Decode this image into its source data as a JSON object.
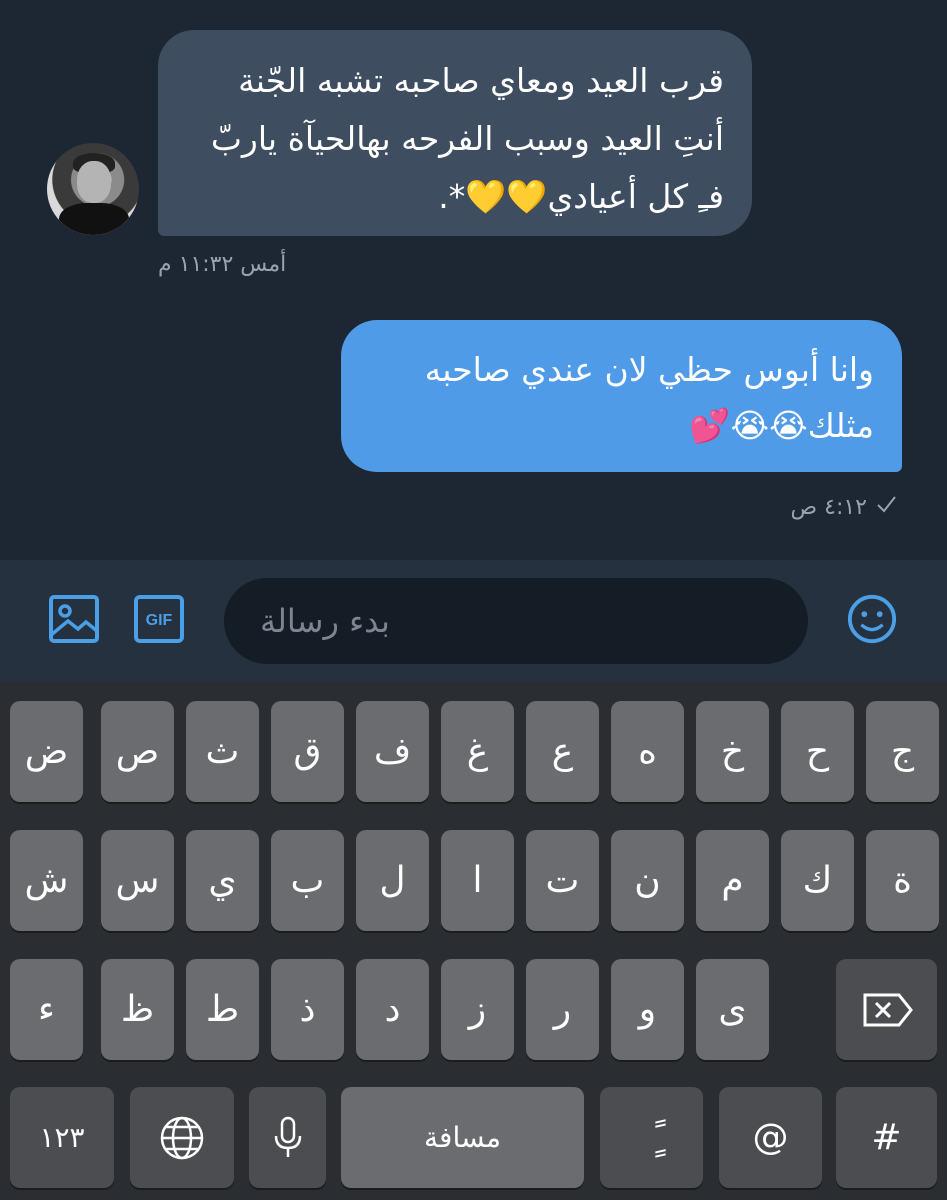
{
  "messages": {
    "incoming": {
      "lines": [
        "قرب العيد ومعاي صاحبه تشبه الجّنة",
        "أنتِ العيد وسبب الفرحه بهالحيآة ياربّ",
        "فـِ كل أعيادي💛💛*."
      ],
      "time": "أمس ١١:٣٢ م"
    },
    "outgoing": {
      "lines": [
        "وانا أبوس حظي لان عندي صاحبه",
        "مثلك😭😭💕"
      ],
      "time": "٤:١٢ ص",
      "status_icon": "check-icon"
    }
  },
  "composer": {
    "placeholder": "بدء رسالة",
    "gif_label": "GIF",
    "icons": [
      "image-icon",
      "gif-icon",
      "smiley-icon"
    ]
  },
  "keyboard": {
    "row1": [
      "ج",
      "ح",
      "خ",
      "ه",
      "ع",
      "غ",
      "ف",
      "ق",
      "ث",
      "ص",
      "ض"
    ],
    "row2": [
      "ة",
      "ك",
      "م",
      "ن",
      "ت",
      "ا",
      "ل",
      "ب",
      "ي",
      "س",
      "ش"
    ],
    "row3": [
      "ى",
      "و",
      "ر",
      "ز",
      "د",
      "ذ",
      "ط",
      "ظ",
      "ء"
    ],
    "bottom": {
      "numbers": "١٢٣",
      "space": "مسافة",
      "diacritic": "ًٍ",
      "at": "@",
      "hash": "#"
    }
  },
  "colors": {
    "background": "#1d2633",
    "incoming_bubble": "#3e4d5f",
    "outgoing_bubble": "#4f9be8",
    "accent": "#4a9fe6"
  }
}
